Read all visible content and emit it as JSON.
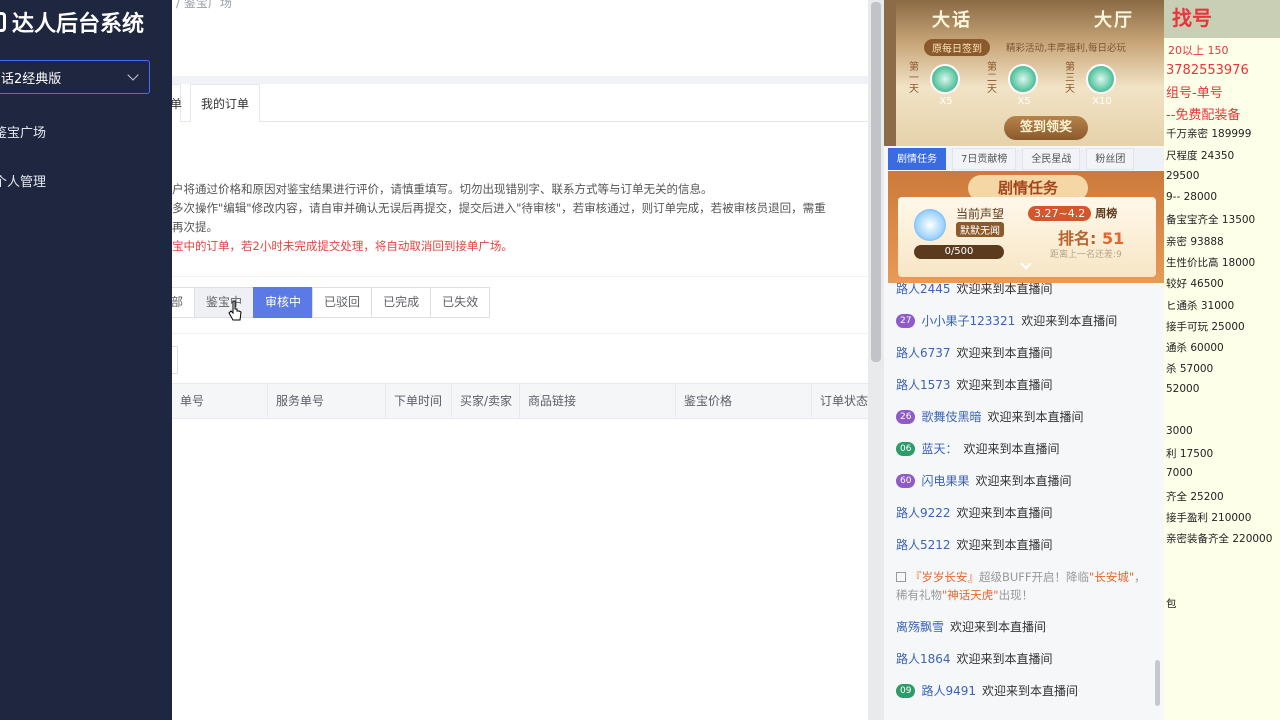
{
  "sidebar": {
    "brand": "达人后台系统",
    "game_select": "话2经典版",
    "items": [
      {
        "label": "鉴宝广场"
      },
      {
        "label": "个人管理"
      }
    ]
  },
  "main": {
    "breadcrumb": "/ 鉴宝广场",
    "tabs": [
      {
        "label": "单"
      },
      {
        "label": "我的订单"
      }
    ],
    "notice": [
      "户将通过价格和原因对鉴宝结果进行评价，请慎重填写。切勿出现错别字、联系方式等与订单无关的信息。",
      "多次操作\"编辑\"修改内容，请自审并确认无误后再提交，提交后进入\"待审核\"，若审核通过，则订单完成，若被审核员退回，需重",
      "再次提。"
    ],
    "notice_red": "宝中的订单，若2小时未完成提交处理，将自动取消回到接单广场。",
    "filters": [
      {
        "label": "部",
        "state": "normal"
      },
      {
        "label": "鉴宝中",
        "state": "hover"
      },
      {
        "label": "审核中",
        "state": "active"
      },
      {
        "label": "已驳回",
        "state": "normal"
      },
      {
        "label": "已完成",
        "state": "normal"
      },
      {
        "label": "已失效",
        "state": "normal"
      }
    ],
    "table_headers": [
      "单号",
      "服务单号",
      "下单时间",
      "买家/卖家",
      "商品链接",
      "鉴宝价格",
      "订单状态"
    ]
  },
  "live": {
    "banner": {
      "title_left": "大话",
      "title_right": "大厅",
      "daily_pill": "原每日签到",
      "daily_desc": "精彩活动,丰厚福利,每日必玩",
      "days": [
        {
          "label": "第一天",
          "count": "X5"
        },
        {
          "label": "第二天",
          "count": "X5"
        },
        {
          "label": "第三天",
          "count": "X10"
        }
      ],
      "signin_button": "签到领奖"
    },
    "tabs": [
      {
        "label": "剧情任务",
        "active": true
      },
      {
        "label": "7日贡献榜",
        "active": false
      },
      {
        "label": "全民星战",
        "active": false
      },
      {
        "label": "粉丝团",
        "active": false
      }
    ],
    "quest": {
      "title": "剧情任务",
      "name": "当前声望",
      "sub": "默默无闻",
      "progress": "0/500",
      "week": "3.27~4.2",
      "week_label": "周榜",
      "rank_label": "排名:",
      "rank": "51",
      "next": "距离上一名还差:9"
    },
    "chat": [
      {
        "user": "路人2445",
        "text": "欢迎来到本直播间",
        "badge": ""
      },
      {
        "user": "小小果子123321",
        "text": "欢迎来到本直播间",
        "badge": "27"
      },
      {
        "user": "路人6737",
        "text": "欢迎来到本直播间",
        "badge": ""
      },
      {
        "user": "路人1573",
        "text": "欢迎来到本直播间",
        "badge": ""
      },
      {
        "user": "歌舞伎黑暗",
        "text": "欢迎来到本直播间",
        "badge": "26"
      },
      {
        "user": "蓝天：",
        "text": "欢迎来到本直播间",
        "badge": "06"
      },
      {
        "user": "闪电果果",
        "text": "欢迎来到本直播间",
        "badge": "60"
      },
      {
        "user": "路人9222",
        "text": "欢迎来到本直播间",
        "badge": ""
      },
      {
        "user": "路人5212",
        "text": "欢迎来到本直播间",
        "badge": ""
      },
      {
        "user": "离殇飘雪",
        "text": "欢迎来到本直播间",
        "badge": ""
      },
      {
        "user": "路人1864",
        "text": "欢迎来到本直播间",
        "badge": ""
      },
      {
        "user": "路人9491",
        "text": "欢迎来到本直播间",
        "badge": "09"
      }
    ],
    "system": {
      "a": "『岁岁长安』",
      "b": "超级BUFF开启！降临",
      "c": "\"长安城\"",
      "d": "，稀有礼物",
      "e": "\"神话天虎\"",
      "f": "出现！"
    }
  },
  "overlay": {
    "title": "找号",
    "lines": [
      "20以上 150",
      "3782553976",
      "组号-单号",
      "--免费配装备",
      "千万亲密 189999",
      "尺程度 24350",
      "29500",
      "9-- 28000",
      "备宝宝齐全 13500",
      "亲密 93888",
      "生性价比高 18000",
      "较好 46500",
      "ヒ通杀 31000",
      "接手可玩 25000",
      "通杀 60000",
      "杀 57000",
      "52000",
      "3000",
      "利 17500",
      "7000",
      "齐全 25200",
      "接手盈利 210000",
      "亲密装备齐全 220000",
      "包"
    ]
  }
}
